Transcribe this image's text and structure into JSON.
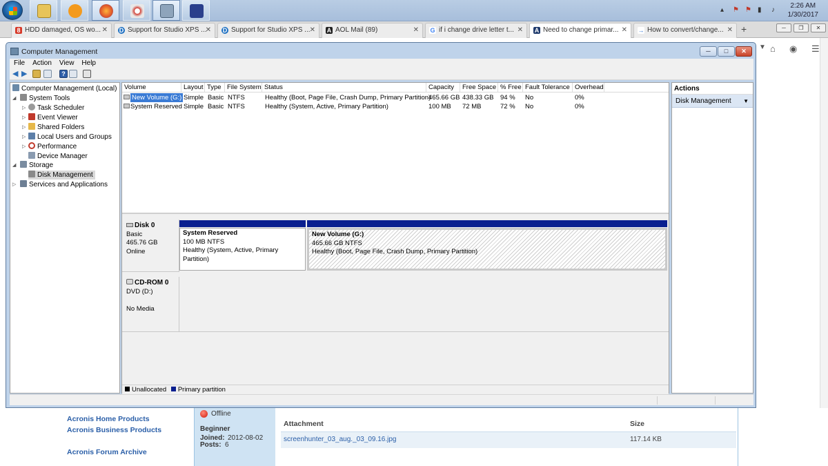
{
  "taskbar": {
    "clock_time": "2:26 AM",
    "clock_date": "1/30/2017"
  },
  "tabs": [
    {
      "label": "HDD damaged, OS wo...",
      "fav_color": "#d63a2a",
      "fav_glyph": "8"
    },
    {
      "label": "Support for Studio XPS ...",
      "fav_color": "#1a6ec1",
      "fav_glyph": "D"
    },
    {
      "label": "Support for Studio XPS ...",
      "fav_color": "#1a6ec1",
      "fav_glyph": "D"
    },
    {
      "label": "AOL Mail (89)",
      "fav_color": "#222222",
      "fav_glyph": "A"
    },
    {
      "label": "if i change drive letter t...",
      "fav_color": "#4285f4",
      "fav_glyph": "G"
    },
    {
      "label": "Need to change primar...",
      "fav_color": "#1f3b6d",
      "fav_glyph": "A"
    },
    {
      "label": "How to convert/change...",
      "fav_color": "#3a7bd5",
      "fav_glyph": "→"
    }
  ],
  "window": {
    "title": "Computer Management",
    "menu": [
      "File",
      "Action",
      "View",
      "Help"
    ]
  },
  "tree": [
    {
      "label": "Computer Management (Local)",
      "icon_color": "#6b8aa8"
    },
    {
      "label": "System Tools",
      "icon_color": "#7a7a7a"
    },
    {
      "label": "Task Scheduler",
      "icon_color": "#8a8a8a"
    },
    {
      "label": "Event Viewer",
      "icon_color": "#c0392b"
    },
    {
      "label": "Shared Folders",
      "icon_color": "#e6b84a"
    },
    {
      "label": "Local Users and Groups",
      "icon_color": "#5d7fa8"
    },
    {
      "label": "Performance",
      "icon_color": "#c0392b"
    },
    {
      "label": "Device Manager",
      "icon_color": "#8a9bb0"
    },
    {
      "label": "Storage",
      "icon_color": "#7a8ca0"
    },
    {
      "label": "Disk Management",
      "icon_color": "#8a8a8a"
    },
    {
      "label": "Services and Applications",
      "icon_color": "#6d7f94"
    }
  ],
  "volume_table": {
    "columns": [
      "Volume",
      "Layout",
      "Type",
      "File System",
      "Status",
      "Capacity",
      "Free Space",
      "% Free",
      "Fault Tolerance",
      "Overhead"
    ],
    "rows": [
      [
        "New Volume (G:)",
        "Simple",
        "Basic",
        "NTFS",
        "Healthy (Boot, Page File, Crash Dump, Primary Partition)",
        "465.66 GB",
        "438.33 GB",
        "94 %",
        "No",
        "0%"
      ],
      [
        "System Reserved",
        "Simple",
        "Basic",
        "NTFS",
        "Healthy (System, Active, Primary Partition)",
        "100 MB",
        "72 MB",
        "72 %",
        "No",
        "0%"
      ]
    ]
  },
  "disks": [
    {
      "name": "Disk 0",
      "type": "Basic",
      "size": "465.76 GB",
      "state": "Online",
      "partitions": [
        {
          "name": "System Reserved",
          "size_fs": "100 MB NTFS",
          "status": "Healthy (System, Active, Primary Partition)"
        },
        {
          "name": "New Volume  (G:)",
          "size_fs": "465.66 GB NTFS",
          "status": "Healthy (Boot, Page File, Crash Dump, Primary Partition)"
        }
      ]
    },
    {
      "name": "CD-ROM 0",
      "type": "DVD (D:)",
      "state": "No Media"
    }
  ],
  "legend": {
    "unallocated": "Unallocated",
    "primary": "Primary partition",
    "unallocated_color": "#000000",
    "primary_color": "#0a1f8f"
  },
  "actions": {
    "header": "Actions",
    "item": "Disk Management"
  },
  "webpage": {
    "links": [
      "Acronis Home Products",
      "Acronis Business Products",
      "Acronis Forum Archive"
    ],
    "user_status": "Offline",
    "user_rank": "Beginner",
    "joined_label": "Joined:",
    "joined_value": "2012-08-02",
    "posts_label": "Posts:",
    "posts_value": "6",
    "attachment_header": "Attachment",
    "size_header": "Size",
    "attachment_file": "screenhunter_03_aug._03_09.16.jpg",
    "attachment_size": "117.14 KB"
  }
}
